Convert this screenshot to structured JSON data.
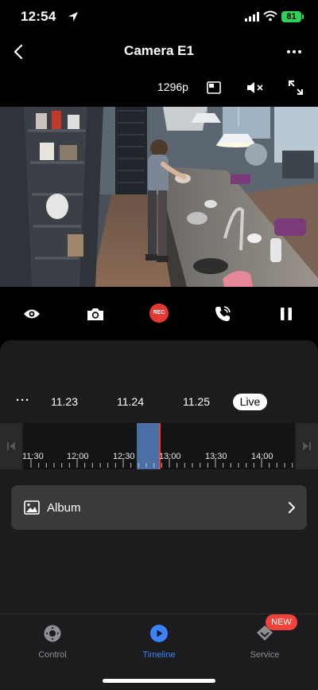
{
  "status_bar": {
    "time": "12:54",
    "battery": "81"
  },
  "nav": {
    "title": "Camera E1"
  },
  "video_toolbar": {
    "resolution": "1296p"
  },
  "controls": {
    "rec_label": "REC"
  },
  "dates": {
    "more": "···",
    "items": [
      "11.23",
      "11.24",
      "11.25"
    ],
    "live": "Live"
  },
  "timeline": {
    "labels": [
      "11:30",
      "12:00",
      "12:30",
      "13:00",
      "13:30",
      "14:00"
    ]
  },
  "album": {
    "label": "Album"
  },
  "tabs": [
    {
      "label": "Control",
      "active": false
    },
    {
      "label": "Timeline",
      "active": true
    },
    {
      "label": "Service",
      "active": false
    }
  ],
  "badge": {
    "new": "NEW"
  },
  "colors": {
    "accent": "#3b82f6",
    "record": "#e53935",
    "playhead": "#ff3b30",
    "timeline_segment": "#4a6fa5",
    "battery": "#30d158"
  }
}
